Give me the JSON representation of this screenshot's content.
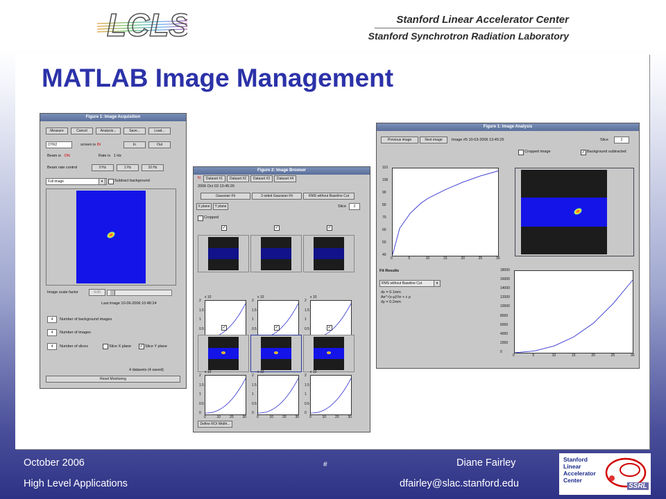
{
  "header": {
    "logo_text": "LCLS",
    "institution_1": "Stanford Linear Accelerator Center",
    "institution_2": "Stanford Synchrotron Radiation Laboratory"
  },
  "slide": {
    "title": "MATLAB Image Management"
  },
  "win1": {
    "title": "Figure 1: Image Acquisition",
    "buttons": [
      "Measure",
      "Cancel",
      "Analysis...",
      "Save...",
      "Load..."
    ],
    "screen_select": "OTR2",
    "screen_is_label": "screen is",
    "screen_state": "IN",
    "in_btn": "In",
    "out_btn": "Out",
    "beam_is_label": "Beam is",
    "beam_state": "ON",
    "rate_is_label": "Rate is",
    "rate_value": "1 Hz",
    "beam_rate_control": "Beam rate control",
    "rate_buttons": [
      "0 Hz",
      "1 Hz",
      "10 Hz"
    ],
    "image_select": "Full image",
    "subtract_bg": "Subtract background",
    "scale_label": "Image scale factor",
    "scale_value": "4.00",
    "last_image": "Last image 10-06-2006 10:48:24",
    "bg_count": "4",
    "bg_label": "Number of background images",
    "img_count": "4",
    "img_label": "Number of images",
    "slice_count": "4",
    "slice_label": "Number of slices",
    "slice_x": "Slice X plane",
    "slice_y": "Slice Y plane",
    "datasets": "4 datasets (4 saved)",
    "reset": "Reset Monitoring"
  },
  "win2": {
    "title": "Figure 2: Image Browser",
    "tabs": [
      "Dataset #1",
      "Dataset #2",
      "Dataset #3",
      "Dataset #4"
    ],
    "tab_marker": "N",
    "date": "2006 Oct 03 13:45:26",
    "fit_buttons": [
      "Gaussian Fit",
      "2-sided Gaussian Fit",
      "RMS without Baseline Cut"
    ],
    "plane_buttons": [
      "X plane",
      "Y plane"
    ],
    "slice_label": "Slice",
    "slice_value": "2",
    "cropped": "Cropped",
    "define_roi": "Define ROI Width...",
    "x10": "x 10",
    "y_ticks": [
      "2",
      "1.5",
      "1",
      "0.5",
      "0"
    ],
    "x_ticks": [
      "0",
      "10",
      "20",
      "30"
    ]
  },
  "win3": {
    "title": "Figure 1: Image Analysis",
    "prev": "Previous image",
    "next": "Next image",
    "image_info": "Image #5   10-03-2006 13:45:25",
    "slice_label": "Slice",
    "slice_value": "2",
    "cropped": "Cropped image",
    "bg_sub": "Background subtracted",
    "fit_results": "Fit Results",
    "fit_method": "RMS without Baseline Cut",
    "fit_lines": [
      "dx = 0.1mm",
      "Ae^-(x-μ)²/σ + c ρ",
      "dy = 0.2mm"
    ]
  },
  "chart_data": [
    {
      "type": "line",
      "x": [
        0,
        2,
        5,
        8,
        10,
        15,
        20,
        25,
        30
      ],
      "values": [
        41,
        62,
        74,
        82,
        86,
        93,
        99,
        104,
        108
      ],
      "xlim": [
        0,
        30
      ],
      "ylim": [
        40,
        110
      ],
      "x_ticks": [
        "0",
        "5",
        "10",
        "15",
        "20",
        "25",
        "30"
      ],
      "y_ticks": [
        "110",
        "100",
        "90",
        "80",
        "70",
        "60",
        "50",
        "40"
      ]
    },
    {
      "type": "line",
      "x": [
        0,
        5,
        10,
        15,
        20,
        25,
        30
      ],
      "values": [
        0,
        400,
        1500,
        3500,
        6500,
        10800,
        16000
      ],
      "xlim": [
        0,
        30
      ],
      "ylim": [
        0,
        18000
      ],
      "x_ticks": [
        "0",
        "5",
        "10",
        "15",
        "20",
        "25",
        "30"
      ],
      "y_ticks": [
        "18000",
        "16000",
        "14000",
        "12000",
        "10000",
        "8000",
        "6000",
        "4000",
        "2000",
        "0"
      ]
    }
  ],
  "footer": {
    "date": "October 2006",
    "event": "High Level Applications",
    "page_marker": "#",
    "author": "Diane Fairley",
    "email": "dfairley@slac.stanford.edu",
    "logo_lines": [
      "Stanford",
      "Linear",
      "Accelerator",
      "Center"
    ],
    "ssrl": "SSRL"
  },
  "colors": {
    "title": "#2c32a8",
    "beam": "#1414e8",
    "accent_red": "#d00000"
  }
}
